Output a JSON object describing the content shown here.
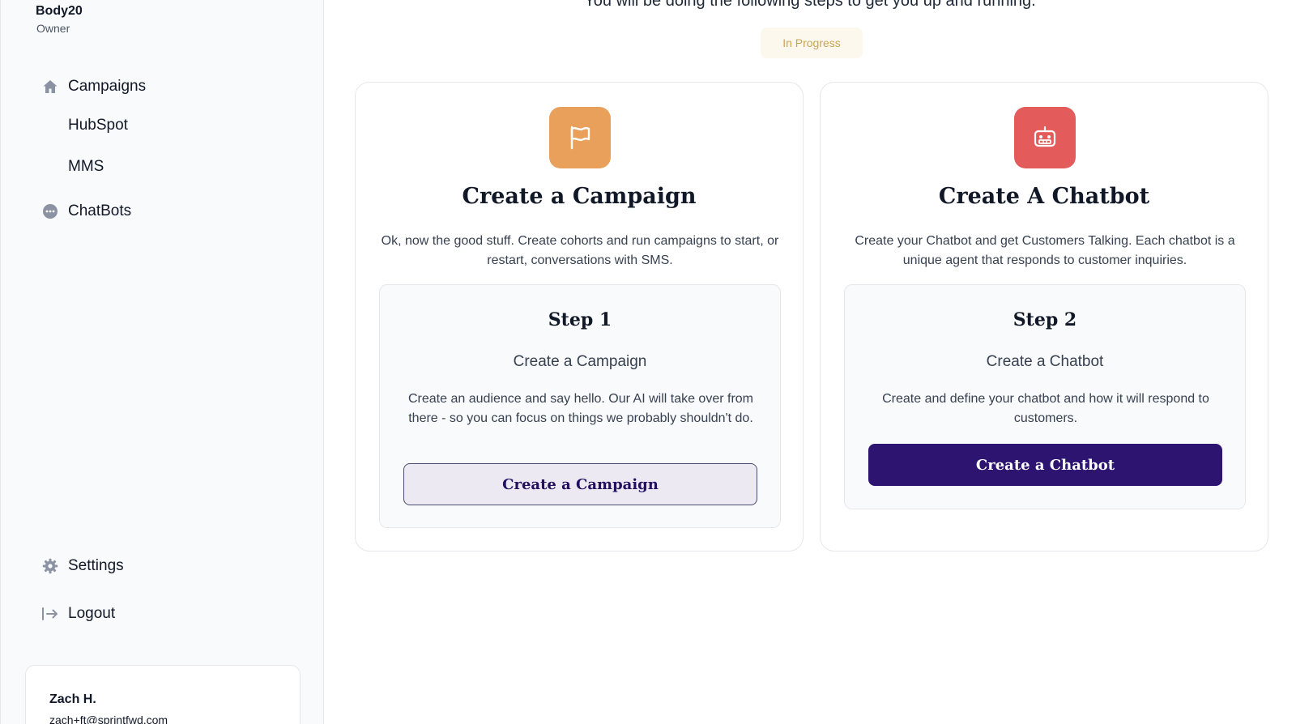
{
  "org": {
    "name": "Body20",
    "role": "Owner"
  },
  "sidebar": {
    "nav": [
      {
        "label": "Campaigns",
        "icon": "home-icon"
      },
      {
        "label": "HubSpot"
      },
      {
        "label": "MMS"
      },
      {
        "label": "ChatBots",
        "icon": "chat-bubble-icon"
      }
    ],
    "settings_label": "Settings",
    "logout_label": "Logout"
  },
  "user": {
    "name": "Zach H.",
    "email": "zach+ft@sprintfwd.com"
  },
  "main": {
    "intro": "You will be doing the following steps to get you up and running.",
    "status_badge": "In Progress",
    "cards": [
      {
        "icon": "flag-icon",
        "icon_color": "#E8A05A",
        "title": "Create a Campaign",
        "description": "Ok, now the good stuff. Create cohorts and run campaigns to start, or restart, conversations with SMS.",
        "step_title": "Step 1",
        "step_subtitle": "Create a Campaign",
        "step_description": "Create an audience and say hello. Our AI will take over from there - so you can focus on things we probably shouldn't do.",
        "button_label": "Create a Campaign"
      },
      {
        "icon": "robot-icon",
        "icon_color": "#E35B5B",
        "title": "Create A Chatbot",
        "description": "Create your Chatbot and get Customers Talking. Each chatbot is a unique agent that responds to customer inquiries.",
        "step_title": "Step 2",
        "step_subtitle": "Create a Chatbot",
        "step_description": "Create and define your chatbot and how it will respond to customers.",
        "button_label": "Create a Chatbot"
      }
    ]
  },
  "colors": {
    "accent_dark": "#2D1470",
    "badge_text": "#C9A457",
    "badge_bg": "#FCF8EE"
  }
}
